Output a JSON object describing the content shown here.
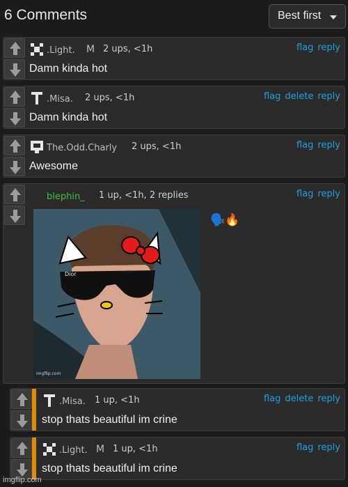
{
  "header": {
    "title": "6 Comments",
    "sort_label": "Best first"
  },
  "comments": [
    {
      "username": ".Light.",
      "badge": "M",
      "stats": "2 ups, <1h",
      "actions": [
        "flag",
        "reply"
      ],
      "text": "Damn kinda hot"
    },
    {
      "username": ".Misa.",
      "stats": "2 ups, <1h",
      "actions": [
        "flag",
        "delete",
        "reply"
      ],
      "text": "Damn kinda hot"
    },
    {
      "username": "The.Odd.Charly",
      "stats": "2 ups, <1h",
      "actions": [
        "flag",
        "reply"
      ],
      "text": "Awesome"
    },
    {
      "username": "blephin_",
      "stats": "1 up, <1h, 2 replies",
      "actions": [
        "flag",
        "reply"
      ],
      "emoji": "🗣️🔥",
      "image": {
        "overlay_text": "Dior",
        "credit": "imgflip.com"
      }
    },
    {
      "username": ".Misa.",
      "stats": "1 up, <1h",
      "actions": [
        "flag",
        "delete",
        "reply"
      ],
      "text": "stop thats beautiful im crine"
    },
    {
      "username": ".Light.",
      "badge": "M",
      "stats": "1 up, <1h",
      "actions": [
        "flag",
        "reply"
      ],
      "text": "stop thats beautiful im crine"
    }
  ],
  "colors": {
    "accent": "#1ea0e0",
    "reply_bar": "#e08a0c",
    "green_user": "#3fbf3f"
  },
  "watermark": "imgflip.com"
}
